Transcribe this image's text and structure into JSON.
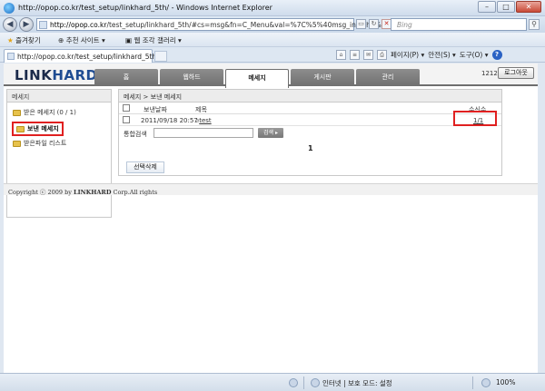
{
  "window": {
    "title": "http://opop.co.kr/test_setup/linkhard_5th/ - Windows Internet Explorer",
    "buttons": [
      "–",
      "□",
      "✕"
    ]
  },
  "addressbar": {
    "url_host": "http://opop.co.kr",
    "url_rest": "/test_setup/linkhard_5th/#cs=msg&fn=C_Menu&val=%7C%5%40msg_inc.php%7C",
    "search_placeholder": "Bing"
  },
  "favorites": {
    "favorites_label": "즐겨찾기",
    "suggested_sites": "추천 사이트 ▾",
    "web_slice_gallery": "웹 조각 갤러리 ▾"
  },
  "tabs": [
    {
      "label": "http://opop.co.kr/test_setup/linkhard_5th/"
    }
  ],
  "commandbar": {
    "page": "페이지(P) ▾",
    "safety": "안전(S) ▾",
    "tools": "도구(O) ▾"
  },
  "site": {
    "logo_prefix": "LINK",
    "logo_suffix": "HARD",
    "nav": [
      "홈",
      "웹하드",
      "메세지",
      "게시판",
      "관리"
    ],
    "active_nav_index": 2,
    "user_id": "1212",
    "logout_label": "로그아웃"
  },
  "sidebar": {
    "title": "메세지",
    "items": [
      {
        "label": "받은 메세지 (0 / 1)",
        "selected": false
      },
      {
        "label": "보낸 메세지",
        "selected": true
      },
      {
        "label": "받은파일 리스트",
        "selected": false
      }
    ]
  },
  "messages": {
    "breadcrumb": "메세지 > 보낸 메세지",
    "columns": {
      "date": "보낸날짜",
      "subject": "제목",
      "receivers": "수신수"
    },
    "rows": [
      {
        "date": "2011/09/18 20:57",
        "subject": "test",
        "receivers": "1/1"
      }
    ],
    "search_label": "통합검색",
    "search_button": "검색",
    "page": "1",
    "delete_button": "선택삭제"
  },
  "footer": {
    "copyright": "Copyright ⓒ 2009 by",
    "brand": "LINKHARD",
    "rest": "Corp.All rights"
  },
  "statusbar": {
    "zone": "인터넷 | 보호 모드: 설정",
    "zoom": "100%"
  },
  "colors": {
    "highlight": "#e02020",
    "nav_tab": "#7f7f7f",
    "logo": "#1f4c92"
  }
}
